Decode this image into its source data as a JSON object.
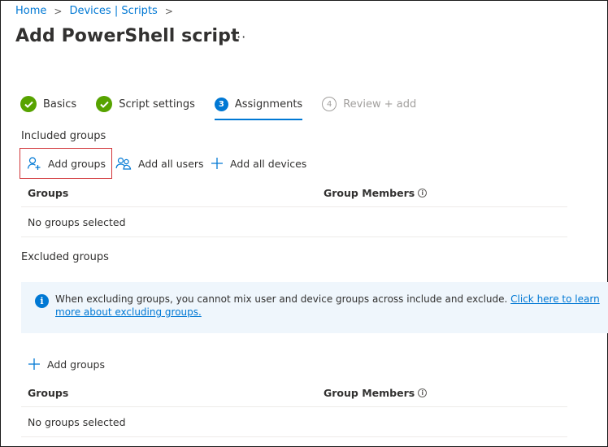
{
  "breadcrumb": {
    "home": "Home",
    "devices_scripts": "Devices | Scripts"
  },
  "page": {
    "title": "Add PowerShell script",
    "more": "···"
  },
  "steps": [
    {
      "label": "Basics",
      "state": "done"
    },
    {
      "label": "Script settings",
      "state": "done"
    },
    {
      "label": "Assignments",
      "number": "3",
      "state": "active"
    },
    {
      "label": "Review + add",
      "number": "4",
      "state": "todo"
    }
  ],
  "included": {
    "label": "Included groups",
    "add_groups": "Add groups",
    "add_all_users": "Add all users",
    "add_all_devices": "Add all devices",
    "col_groups": "Groups",
    "col_members": "Group Members",
    "empty": "No groups selected"
  },
  "excluded": {
    "label": "Excluded groups",
    "banner_text": "When excluding groups, you cannot mix user and device groups across include and exclude.",
    "banner_link": "Click here to learn more about excluding groups.",
    "add_groups": "Add groups",
    "col_groups": "Groups",
    "col_members": "Group Members",
    "empty": "No groups selected"
  },
  "colors": {
    "accent": "#0078d4",
    "success": "#57a300",
    "highlight": "#d13438",
    "banner_bg": "#eff6fc"
  }
}
